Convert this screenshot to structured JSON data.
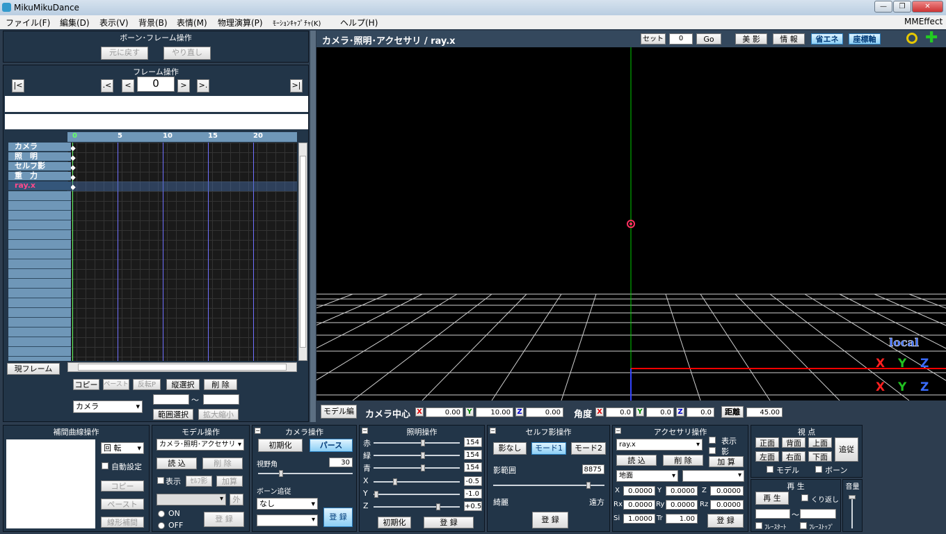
{
  "window": {
    "title": "MikuMikuDance",
    "min": "—",
    "max": "❐",
    "close": "✕"
  },
  "menu": [
    "ファイル(F)",
    "編集(D)",
    "表示(V)",
    "背景(B)",
    "表情(M)",
    "物理演算(P)",
    "ﾓｰｼｮﾝｷｬﾌﾟﾁｬ(K)",
    "ヘルプ(H)"
  ],
  "menu_right": "MMEffect",
  "bone_frame": {
    "title": "ボーン･フレーム操作",
    "undo": "元に戻す",
    "redo": "やり直し"
  },
  "frame_ops": {
    "title": "フレーム操作",
    "first": "|<",
    "prev_key": ".<",
    "prev": "<",
    "frame": "0",
    "next": ">",
    "next_key": ">.",
    "last": ">|"
  },
  "timeline": {
    "ticks": [
      "0",
      "5",
      "10",
      "15",
      "20"
    ],
    "rows": [
      "カメラ",
      "照　明",
      "セルフ影",
      "重　力",
      "ray.x"
    ],
    "current_frame_btn": "現フレーム"
  },
  "edit_buttons": {
    "copy": "コピー",
    "paste": "ペースト",
    "reverse": "反転P",
    "vselect": "縦選択",
    "delete": "削 除",
    "range_select": "範囲選択",
    "scale": "拡大縮小",
    "target": "カメラ",
    "tilde": "〜"
  },
  "viewport": {
    "title": "カメラ･照明･アクセサリ / ray.x",
    "set": "セット",
    "frame": "0",
    "go": "Go",
    "bieffect": "美 影",
    "info": "情 報",
    "eco": "省エネ",
    "axis": "座標軸",
    "local": "local",
    "axis_labels": [
      "X",
      "Y",
      "Z"
    ]
  },
  "camera_bar": {
    "model_edit": "モデル編",
    "center": "カメラ中心",
    "x": "0.00",
    "y": "10.00",
    "z": "0.00",
    "angle": "角度",
    "ax": "0.0",
    "ay": "0.0",
    "az": "0.0",
    "distance": "距離",
    "dist": "45.00"
  },
  "interp": {
    "title": "補間曲線操作",
    "rotate": "回 転",
    "auto": "自動設定",
    "copy": "コピー",
    "paste": "ペースト",
    "linear": "線形補間"
  },
  "model_ops": {
    "title": "モデル操作",
    "target": "カメラ･照明･アクセサリ",
    "load": "読 込",
    "delete": "削 除",
    "show": "表示",
    "selfshadow": "ｾﾙﾌ影",
    "add": "加算",
    "outer": "外",
    "on": "ON",
    "off": "OFF",
    "register": "登 録"
  },
  "camera_ops": {
    "title": "カメラ操作",
    "init": "初期化",
    "perspective": "パース",
    "fov_label": "視野角",
    "fov": "30",
    "bone_follow": "ボーン追従",
    "follow": "なし",
    "register": "登 録"
  },
  "light_ops": {
    "title": "照明操作",
    "r_label": "赤",
    "g_label": "緑",
    "b_label": "青",
    "r": "154",
    "g": "154",
    "b": "154",
    "x": "-0.5",
    "y": "-1.0",
    "z": "+0.5",
    "init": "初期化",
    "register": "登 録"
  },
  "selfshadow_ops": {
    "title": "セルフ影操作",
    "none": "影なし",
    "mode1": "モード1",
    "mode2": "モード2",
    "range_label": "影範囲",
    "range": "8875",
    "near": "綺麗",
    "far": "遠方",
    "register": "登 録"
  },
  "accessory_ops": {
    "title": "アクセサリ操作",
    "target": "ray.x",
    "load": "読 込",
    "delete": "削 除",
    "add": "加 算",
    "show": "表示",
    "shadow": "影",
    "parent": "地面",
    "x": "0.0000",
    "y": "0.0000",
    "z": "0.0000",
    "rx": "0.0000",
    "ry": "0.0000",
    "rz": "0.0000",
    "si": "1.0000",
    "tr": "1.00",
    "register": "登 録"
  },
  "view_ops": {
    "title": "視 点",
    "front": "正面",
    "back": "背面",
    "top": "上面",
    "left": "左面",
    "right": "右面",
    "bottom": "下面",
    "follow": "追従",
    "model": "モデル",
    "bone": "ボーン"
  },
  "play_ops": {
    "title": "再 生",
    "play": "再 生",
    "repeat": "くり返し",
    "tilde": "〜",
    "fstart": "ﾌﾚｰｽﾀｰﾄ",
    "fstop": "ﾌﾚｰｽﾄｯﾌﾟ"
  },
  "volume": {
    "title": "音量"
  },
  "colors": {
    "panel_bg": "#223548",
    "viewport_bg": "#000000",
    "x_axis": "#ff0000",
    "y_axis": "#00cc00",
    "z_axis": "#3344ff",
    "accent": "#1a8fd8"
  }
}
